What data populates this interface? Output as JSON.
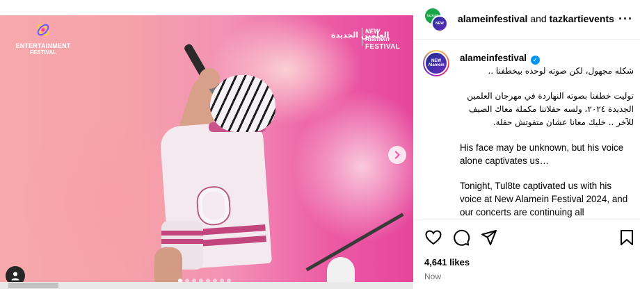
{
  "media": {
    "entertainment_logo": {
      "line1": "ENTERTAINMENT",
      "line2": "FESTIVAL"
    },
    "festival_logo": {
      "arabic": "العلمين الجديدة",
      "line1": "NEW Alamein",
      "line2": "FESTIVAL"
    },
    "carousel": {
      "slide_count": 8,
      "active_index": 0
    },
    "icons": {
      "next": "chevron-right-icon",
      "tagged_users": "user-icon"
    }
  },
  "header": {
    "account1": "alameinfestival",
    "connector": "and",
    "account2": "tazkartievents",
    "avatar1_text": "tazkarti",
    "avatar2_text": "NEW Alamein FESTIVAL",
    "more_icon": "more-horizontal-icon"
  },
  "caption": {
    "username": "alameinfestival",
    "verified": true,
    "arabic_line1": "شكله مجهول، لكن صوته لوحده بيخطفنا ..",
    "arabic_para2": "توليت خطفنا بصوته النهاردة في مهرجان العلمين الجديدة ٢٠٢٤، ولسه حفلاتنا مكملة معاك الصيف للآخر .. خليك معانا عشان متفوتش حفلة.",
    "english_para1": "His face may be unknown, but his voice alone captivates us…",
    "english_para2": "Tonight, Tul8te captivated us with his voice at New Alamein Festival 2024, and our concerts are continuing all"
  },
  "actions": {
    "icons": [
      "heart-icon",
      "comment-icon",
      "share-icon",
      "bookmark-icon"
    ],
    "likes": "4,641 likes",
    "time": "Now"
  },
  "colors": {
    "accent": "#0095f6",
    "stage_pink": "#ec5aa4",
    "stripe": "#c2457e"
  }
}
